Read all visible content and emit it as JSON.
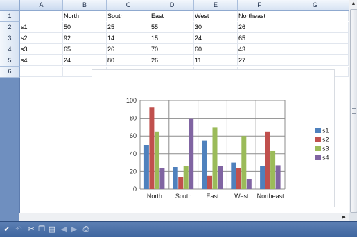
{
  "columns": [
    "A",
    "B",
    "C",
    "D",
    "E",
    "F",
    "G"
  ],
  "rows": [
    "1",
    "2",
    "3",
    "4",
    "5",
    "6"
  ],
  "cells": [
    [
      "",
      "North",
      "South",
      "East",
      "West",
      "Northeast",
      ""
    ],
    [
      "s1",
      "50",
      "25",
      "55",
      "30",
      "26",
      ""
    ],
    [
      "s2",
      "92",
      "14",
      "15",
      "24",
      "65",
      ""
    ],
    [
      "s3",
      "65",
      "26",
      "70",
      "60",
      "43",
      ""
    ],
    [
      "s4",
      "24",
      "80",
      "26",
      "11",
      "27",
      ""
    ],
    [
      "",
      "",
      "",
      "",
      "",
      "",
      ""
    ]
  ],
  "chart_data": {
    "type": "bar",
    "title": "",
    "xlabel": "",
    "ylabel": "",
    "categories": [
      "North",
      "South",
      "East",
      "West",
      "Northeast"
    ],
    "series": [
      {
        "name": "s1",
        "values": [
          50,
          25,
          55,
          30,
          26
        ],
        "color": "#4f81bd"
      },
      {
        "name": "s2",
        "values": [
          92,
          14,
          15,
          24,
          65
        ],
        "color": "#c0504d"
      },
      {
        "name": "s3",
        "values": [
          65,
          26,
          70,
          60,
          43
        ],
        "color": "#9bbb59"
      },
      {
        "name": "s4",
        "values": [
          24,
          80,
          26,
          11,
          27
        ],
        "color": "#8064a2"
      }
    ],
    "ylim": [
      0,
      100
    ],
    "yticks": [
      "0",
      "20",
      "40",
      "60",
      "80",
      "100"
    ],
    "grid": true,
    "legend_position": "right"
  },
  "toolbar": {
    "icons": [
      "checkmark-icon",
      "undo-icon",
      "cut-icon",
      "copy-icon",
      "paste-icon",
      "previous-icon",
      "next-icon",
      "print-icon"
    ]
  }
}
